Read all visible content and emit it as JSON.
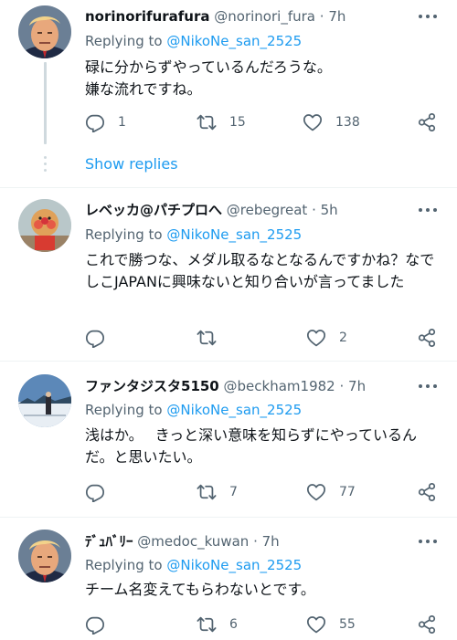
{
  "tweets": [
    {
      "name": "norinorifurafura",
      "handle": "@norinori_fura",
      "time": "7h",
      "replying_prefix": "Replying to ",
      "replying_to": "@NikoNe_san_2525",
      "text": "碌に分からずやっているんだろうな。\n嫌な流れですね。",
      "replies": "1",
      "retweets": "15",
      "likes": "138",
      "avatar": "trump-photo"
    },
    {
      "name": "レベッカ@パチプロへ",
      "handle": "@rebegreat",
      "time": "5h",
      "replying_prefix": "Replying to ",
      "replying_to": "@NikoNe_san_2525",
      "text": "これで勝つな、メダル取るなとなるんですかね？なでしこJAPANに興味ないと知り合いが言ってました",
      "replies": "",
      "retweets": "",
      "likes": "2",
      "avatar": "anpanman-figure"
    },
    {
      "name": "ファンタジスタ5150",
      "handle": "@beckham1982",
      "time": "7h",
      "replying_prefix": "Replying to ",
      "replying_to": "@NikoNe_san_2525",
      "text": "浅はか。　 きっと深い意味を知らずにやっているんだ。と思いたい。",
      "replies": "",
      "retweets": "7",
      "likes": "77",
      "avatar": "snow-landscape"
    },
    {
      "name": "ﾃﾞｭﾊﾞﾘｰ",
      "handle": "@medoc_kuwan",
      "time": "7h",
      "replying_prefix": "Replying to ",
      "replying_to": "@NikoNe_san_2525",
      "text": "チーム名変えてもらわないとです。",
      "replies": "",
      "retweets": "6",
      "likes": "55",
      "avatar": "trump-photo"
    }
  ],
  "show_replies": "Show replies",
  "separator": "·",
  "colors": {
    "link": "#1d9bf0",
    "muted": "#536471",
    "text": "#0f1419",
    "border": "#eff3f4"
  },
  "icons": [
    "reply-icon",
    "retweet-icon",
    "like-icon",
    "share-icon",
    "more-icon"
  ]
}
